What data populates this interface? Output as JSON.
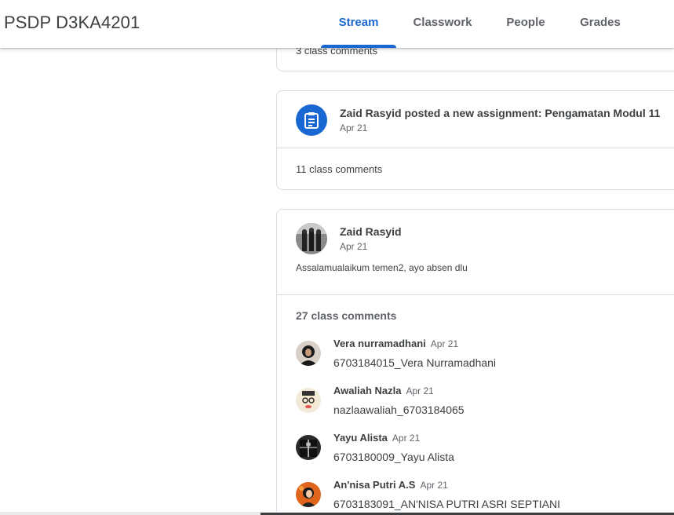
{
  "header": {
    "class_title": "PSDP D3KA4201",
    "tabs": [
      {
        "label": "Stream",
        "active": true
      },
      {
        "label": "Classwork",
        "active": false
      },
      {
        "label": "People",
        "active": false
      },
      {
        "label": "Grades",
        "active": false
      }
    ]
  },
  "stream": {
    "prev_card": {
      "comments_link": "3 class comments"
    },
    "assignment_card": {
      "icon": "assignment-icon",
      "title": "Zaid Rasyid posted a new assignment: Pengamatan Modul 11",
      "date": "Apr 21",
      "comments_link": "11 class comments"
    },
    "announcement_card": {
      "author": "Zaid Rasyid",
      "date": "Apr 21",
      "text": "Assalamualaikum temen2, ayo absen dlu",
      "comments_count": "27 class comments",
      "comments": [
        {
          "name": "Vera nurramadhani",
          "date": "Apr 21",
          "text": "6703184015_Vera Nurramadhani"
        },
        {
          "name": "Awaliah Nazla",
          "date": "Apr 21",
          "text": "nazlaawaliah_6703184065"
        },
        {
          "name": "Yayu Alista",
          "date": "Apr 21",
          "text": "6703180009_Yayu Alista"
        },
        {
          "name": "An'nisa Putri A.S",
          "date": "Apr 21",
          "text": "6703183091_AN'NISA PUTRI ASRI SEPTIANI"
        }
      ]
    }
  },
  "colors": {
    "accent": "#1967d2",
    "text": "#3c4043",
    "muted": "#5f6368",
    "border": "#dadce0"
  }
}
